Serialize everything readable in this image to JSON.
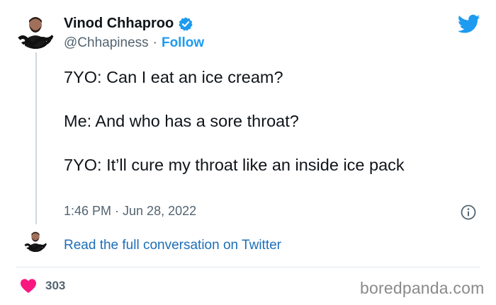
{
  "author": {
    "display_name": "Vinod Chhaproo",
    "handle": "@Chhapiness",
    "separator": "·",
    "follow_label": "Follow",
    "avatar_caption": "Chhapiness"
  },
  "tweet": {
    "lines": [
      "7YO: Can I eat an ice cream?",
      "Me: And who has a sore throat?",
      "7YO: It’ll cure my throat like an inside ice pack"
    ],
    "timestamp": "1:46 PM · Jun 28, 2022"
  },
  "conversation": {
    "link_label": "Read the full conversation on Twitter"
  },
  "engagement": {
    "like_count": "303"
  },
  "watermark": "boredpanda.com",
  "icons": {
    "verified": "verified-badge-icon",
    "logo": "twitter-bird-icon",
    "info": "info-icon",
    "like": "heart-icon"
  },
  "colors": {
    "brand_blue": "#1d9bf0",
    "link_blue": "#1d6fb8",
    "like_red": "#f91880",
    "muted_text": "#536471"
  }
}
